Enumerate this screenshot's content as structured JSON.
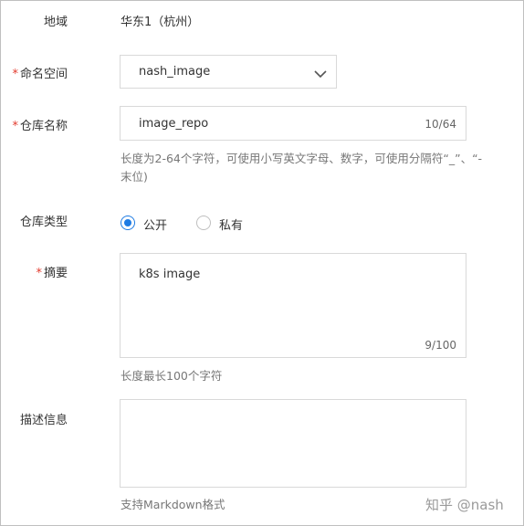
{
  "region": {
    "label": "地域",
    "value": "华东1（杭州）"
  },
  "namespace": {
    "required_mark": "*",
    "label": "命名空间",
    "selected": "nash_image",
    "icon": "chevron-down-icon"
  },
  "repo_name": {
    "required_mark": "*",
    "label": "仓库名称",
    "value": "image_repo",
    "counter": "10/64",
    "hint_line1": "长度为2-64个字符，可使用小写英文字母、数字，可使用分隔符“_”、“-",
    "hint_line2": "末位)"
  },
  "repo_type": {
    "label": "仓库类型",
    "options": [
      {
        "label": "公开",
        "checked": true
      },
      {
        "label": "私有",
        "checked": false
      }
    ]
  },
  "summary": {
    "required_mark": "*",
    "label": "摘要",
    "value": "k8s image",
    "counter": "9/100",
    "hint": "长度最长100个字符"
  },
  "description": {
    "label": "描述信息",
    "value": "",
    "hint": "支持Markdown格式"
  },
  "watermark": "知乎 @nash",
  "colors": {
    "accent": "#1e7be3",
    "required": "#e23b2e",
    "border": "#d9d9d9"
  }
}
